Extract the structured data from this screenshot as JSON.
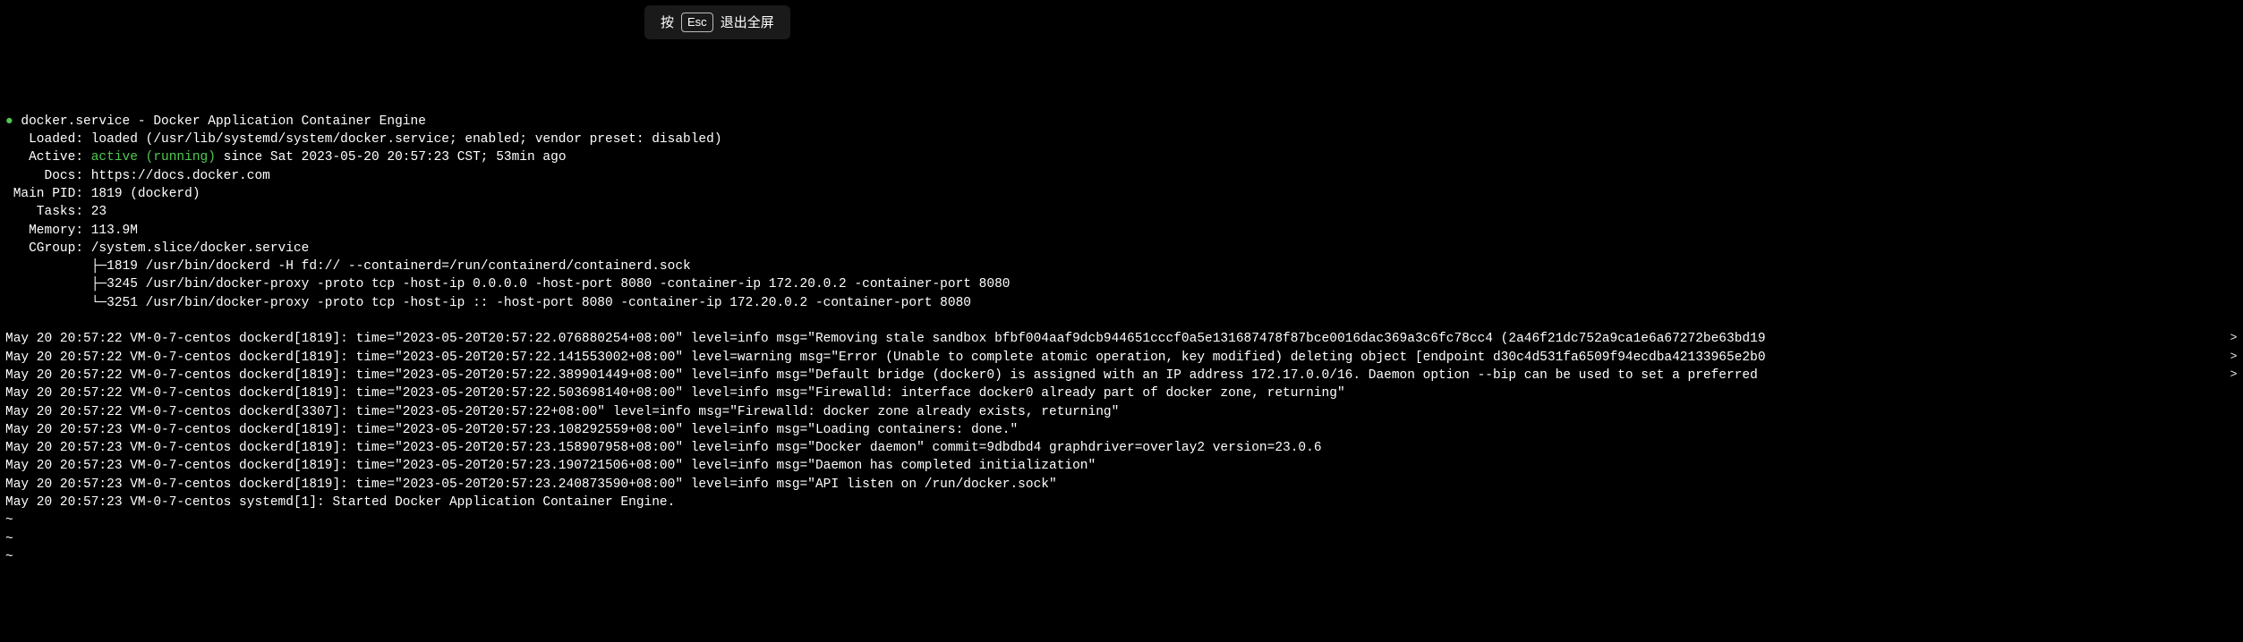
{
  "overlay": {
    "press": "按",
    "key": "Esc",
    "exit_fullscreen": "退出全屏"
  },
  "header": {
    "bullet": "●",
    "service_name": "docker.service",
    "dash": " - ",
    "description": "Docker Application Container Engine"
  },
  "loaded": {
    "label": "   Loaded: ",
    "value": "loaded (/usr/lib/systemd/system/docker.service; enabled; vendor preset: disabled)"
  },
  "active": {
    "label": "   Active: ",
    "state": "active (running)",
    "since": " since Sat 2023-05-20 20:57:23 CST; 53min ago"
  },
  "docs": {
    "label": "     Docs: ",
    "url": "https://docs.docker.com"
  },
  "mainpid": {
    "label": " Main PID: ",
    "value": "1819 (dockerd)"
  },
  "tasks": {
    "label": "    Tasks: ",
    "value": "23"
  },
  "memory": {
    "label": "   Memory: ",
    "value": "113.9M"
  },
  "cgroup": {
    "label": "   CGroup: ",
    "path": "/system.slice/docker.service",
    "proc1": "           ├─1819 /usr/bin/dockerd -H fd:// --containerd=/run/containerd/containerd.sock",
    "proc2": "           ├─3245 /usr/bin/docker-proxy -proto tcp -host-ip 0.0.0.0 -host-port 8080 -container-ip 172.20.0.2 -container-port 8080",
    "proc3": "           └─3251 /usr/bin/docker-proxy -proto tcp -host-ip :: -host-port 8080 -container-ip 172.20.0.2 -container-port 8080"
  },
  "logs": [
    "May 20 20:57:22 VM-0-7-centos dockerd[1819]: time=\"2023-05-20T20:57:22.076880254+08:00\" level=info msg=\"Removing stale sandbox bfbf004aaf9dcb944651cccf0a5e131687478f87bce0016dac369a3c6fc78cc4 (2a46f21dc752a9ca1e6a67272be63bd19",
    "May 20 20:57:22 VM-0-7-centos dockerd[1819]: time=\"2023-05-20T20:57:22.141553002+08:00\" level=warning msg=\"Error (Unable to complete atomic operation, key modified) deleting object [endpoint d30c4d531fa6509f94ecdba42133965e2b0",
    "May 20 20:57:22 VM-0-7-centos dockerd[1819]: time=\"2023-05-20T20:57:22.389901449+08:00\" level=info msg=\"Default bridge (docker0) is assigned with an IP address 172.17.0.0/16. Daemon option --bip can be used to set a preferred ",
    "May 20 20:57:22 VM-0-7-centos dockerd[1819]: time=\"2023-05-20T20:57:22.503698140+08:00\" level=info msg=\"Firewalld: interface docker0 already part of docker zone, returning\"",
    "May 20 20:57:22 VM-0-7-centos dockerd[3307]: time=\"2023-05-20T20:57:22+08:00\" level=info msg=\"Firewalld: docker zone already exists, returning\"",
    "May 20 20:57:23 VM-0-7-centos dockerd[1819]: time=\"2023-05-20T20:57:23.108292559+08:00\" level=info msg=\"Loading containers: done.\"",
    "May 20 20:57:23 VM-0-7-centos dockerd[1819]: time=\"2023-05-20T20:57:23.158907958+08:00\" level=info msg=\"Docker daemon\" commit=9dbdbd4 graphdriver=overlay2 version=23.0.6",
    "May 20 20:57:23 VM-0-7-centos dockerd[1819]: time=\"2023-05-20T20:57:23.190721506+08:00\" level=info msg=\"Daemon has completed initialization\"",
    "May 20 20:57:23 VM-0-7-centos dockerd[1819]: time=\"2023-05-20T20:57:23.240873590+08:00\" level=info msg=\"API listen on /run/docker.sock\"",
    "May 20 20:57:23 VM-0-7-centos systemd[1]: Started Docker Application Container Engine."
  ],
  "tildes": [
    "~",
    "~",
    "~"
  ],
  "scroll_indicator": ">"
}
